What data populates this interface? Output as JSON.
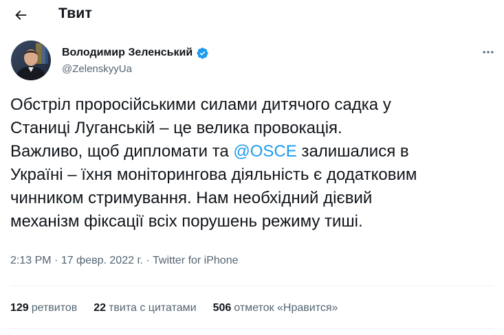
{
  "header": {
    "title": "Твит",
    "back_icon": "arrow-left-icon"
  },
  "author": {
    "name": "Володимир Зеленський",
    "handle": "@ZelenskyyUa",
    "verified_icon": "verified-badge-icon",
    "verified_color": "#1d9bf0"
  },
  "tweet": {
    "lines": [
      "Обстріл проросійськими силами дитячого садка у",
      "Станиці Луганській – це велика провокація.",
      "Важливо, щоб дипломати та ",
      "Україні – їхня моніторингова діяльність є додатковим",
      "чинником стримування. Нам необхідний дієвий",
      "механізм фіксації всіх порушень режиму тиші."
    ],
    "mention": "@OSCE",
    "line3_tail": " залишалися в",
    "mention_color": "#1d9bf0"
  },
  "meta": {
    "time": "2:13 PM",
    "sep1": " · ",
    "date": "17 февр. 2022 г.",
    "sep2": " · ",
    "source": "Twitter for iPhone"
  },
  "stats": {
    "retweets_count": "129",
    "retweets_label": "ретвитов",
    "quotes_count": "22",
    "quotes_label": "твита с цитатами",
    "likes_count": "506",
    "likes_label": "отметок «Нравится»"
  },
  "colors": {
    "text": "#0f1419",
    "secondary": "#536471",
    "accent": "#1d9bf0",
    "divider": "#eff3f4"
  }
}
